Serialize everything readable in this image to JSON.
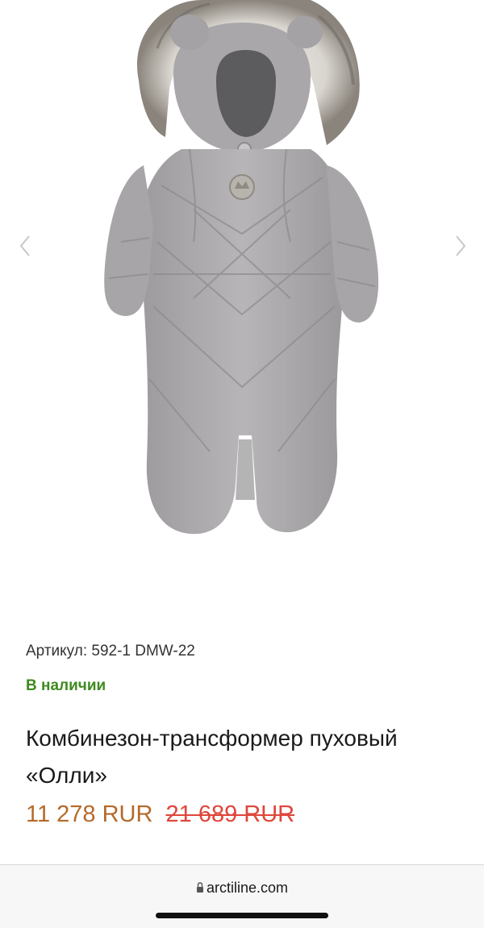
{
  "gallery": {
    "image": "winter-down-jumpsuit-photo",
    "prev_icon": "chevron-left-icon",
    "next_icon": "chevron-right-icon"
  },
  "product": {
    "sku": "Артикул: 592-1 DMW-22",
    "stock": "В наличии",
    "title": "Комбинезон-трансформер пуховый «Олли»",
    "price_current": "11 278 RUR",
    "price_old": "21 689 RUR"
  },
  "browser": {
    "url": "arctiline.com",
    "lock_icon": "lock-icon"
  },
  "colors": {
    "stock": "#3f8a1e",
    "price_current": "#b56a2a",
    "price_old": "#e0463b"
  }
}
